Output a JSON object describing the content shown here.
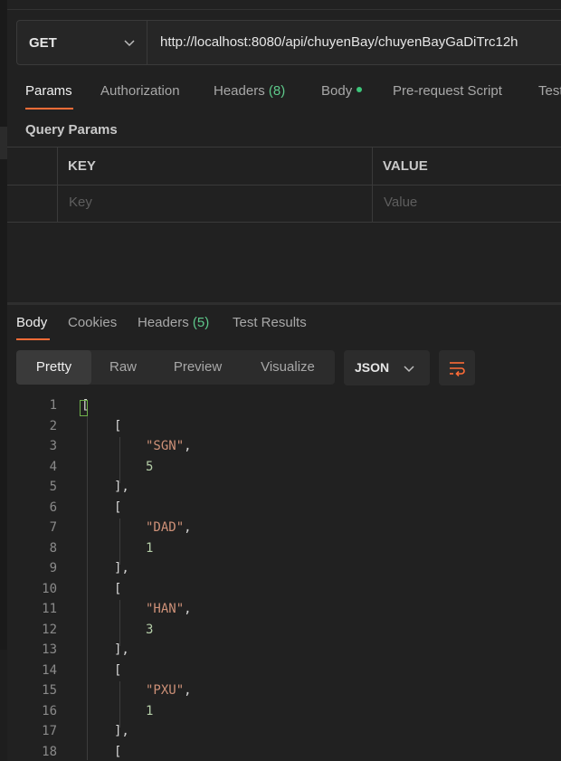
{
  "request": {
    "method": "GET",
    "url": "http://localhost:8080/api/chuyenBay/chuyenBayGaDiTrc12h"
  },
  "request_tabs": {
    "params": "Params",
    "authorization": "Authorization",
    "headers": "Headers",
    "headers_count": "(8)",
    "body": "Body",
    "prerequest": "Pre-request Script",
    "tests": "Tests"
  },
  "query_params": {
    "title": "Query Params",
    "col_key": "KEY",
    "col_value": "VALUE",
    "key_placeholder": "Key",
    "value_placeholder": "Value"
  },
  "response_tabs": {
    "body": "Body",
    "cookies": "Cookies",
    "headers": "Headers",
    "headers_count": "(5)",
    "test_results": "Test Results"
  },
  "view_modes": {
    "pretty": "Pretty",
    "raw": "Raw",
    "preview": "Preview",
    "visualize": "Visualize"
  },
  "format": "JSON",
  "colors": {
    "accent": "#ff6c37",
    "count": "#5ec98b",
    "string": "#ce9178",
    "number": "#b5cea8"
  },
  "code_lines": [
    {
      "n": "1",
      "text": "["
    },
    {
      "n": "2",
      "text": "["
    },
    {
      "n": "3",
      "text": "\"SGN\","
    },
    {
      "n": "4",
      "text": "5"
    },
    {
      "n": "5",
      "text": "],"
    },
    {
      "n": "6",
      "text": "["
    },
    {
      "n": "7",
      "text": "\"DAD\","
    },
    {
      "n": "8",
      "text": "1"
    },
    {
      "n": "9",
      "text": "],"
    },
    {
      "n": "10",
      "text": "["
    },
    {
      "n": "11",
      "text": "\"HAN\","
    },
    {
      "n": "12",
      "text": "3"
    },
    {
      "n": "13",
      "text": "],"
    },
    {
      "n": "14",
      "text": "["
    },
    {
      "n": "15",
      "text": "\"PXU\","
    },
    {
      "n": "16",
      "text": "1"
    },
    {
      "n": "17",
      "text": "],"
    },
    {
      "n": "18",
      "text": "["
    }
  ]
}
